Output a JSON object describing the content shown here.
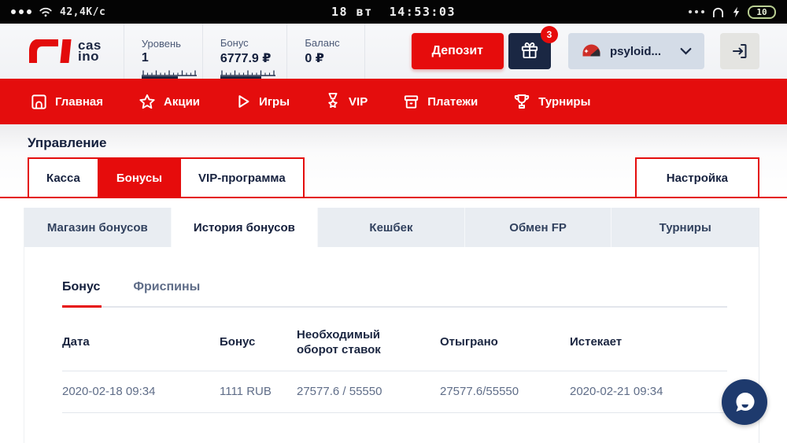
{
  "status_bar": {
    "network_speed": "42,4K/c",
    "datetime": "18 вт  14:53:03",
    "battery_level": "10"
  },
  "header": {
    "logo_top": "cas",
    "logo_bottom": "ino",
    "stats": [
      {
        "label": "Уровень",
        "value": "1",
        "progress_px": "46"
      },
      {
        "label": "Бонус",
        "value": "6777.9 ₽",
        "progress_px": "52"
      },
      {
        "label": "Баланс",
        "value": "0 ₽"
      }
    ],
    "deposit_button": "Депозит",
    "gift_badge_count": "3",
    "username": "psyloid..."
  },
  "nav": {
    "items": [
      {
        "label": "Главная",
        "icon": "home-icon"
      },
      {
        "label": "Акции",
        "icon": "star-icon"
      },
      {
        "label": "Игры",
        "icon": "play-icon"
      },
      {
        "label": "VIP",
        "icon": "medal-icon"
      },
      {
        "label": "Платежи",
        "icon": "payments-icon"
      },
      {
        "label": "Турниры",
        "icon": "trophy-icon"
      }
    ]
  },
  "page": {
    "title": "Управление",
    "main_tabs": [
      {
        "label": "Касса",
        "active": false
      },
      {
        "label": "Бонусы",
        "active": true
      },
      {
        "label": "VIP-программа",
        "active": false
      }
    ],
    "settings_tab_label": "Настройка",
    "sub_tabs": [
      {
        "label": "Магазин бонусов",
        "active": false
      },
      {
        "label": "История бонусов",
        "active": true
      },
      {
        "label": "Кешбек",
        "active": false
      },
      {
        "label": "Обмен FP",
        "active": false
      },
      {
        "label": "Турниры",
        "active": false
      }
    ],
    "inner_tabs": [
      {
        "label": "Бонус",
        "active": true
      },
      {
        "label": "Фриспины",
        "active": false
      }
    ],
    "table": {
      "headers": [
        "Дата",
        "Бонус",
        "Необходимый оборот ставок",
        "Отыграно",
        "Истекает"
      ],
      "rows": [
        {
          "date": "2020-02-18 09:34",
          "bonus": "1111 RUB",
          "required_turnover": "27577.6 / 55550",
          "wagered": "27577.6/55550",
          "expires": "2020-02-21 09:34"
        }
      ]
    }
  },
  "colors": {
    "accent_red": "#e60c0c",
    "dark_navy": "#1c2742",
    "muted_text": "#5f6d88",
    "chat_navy": "#1e3a6d"
  }
}
